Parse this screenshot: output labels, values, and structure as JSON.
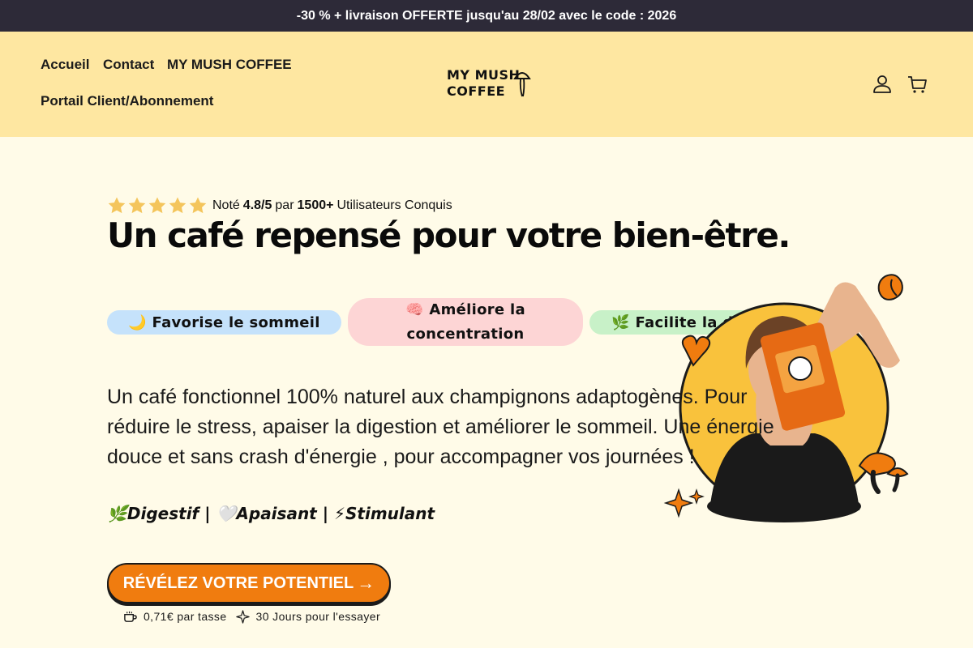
{
  "announcement": "-30 % + livraison OFFERTE jusqu'au 28/02 avec le code : 2026",
  "nav": {
    "items": [
      {
        "label": "Accueil"
      },
      {
        "label": "Contact"
      },
      {
        "label": "MY MUSH COFFEE"
      },
      {
        "label": "Portail Client/Abonnement"
      }
    ]
  },
  "logo": {
    "line1": "MY MUSH",
    "line2": "COFFEE"
  },
  "header_icons": [
    "account-icon",
    "cart-icon"
  ],
  "rating": {
    "stars": 5,
    "prefix": "Noté",
    "score": "4.8/5",
    "middle": "par",
    "count": "1500+",
    "suffix": "Utilisateurs Conquis"
  },
  "hero": {
    "title": "Un café repensé pour votre bien-être.",
    "pills": [
      {
        "label": "🌙 Favorise le sommeil"
      },
      {
        "label": "🧠 Améliore la concentration"
      },
      {
        "label": "🌿 Facilite la digestion"
      }
    ],
    "description": "Un café fonctionnel 100% naturel aux champignons adaptogènes. Pour réduire le stress, apaiser la digestion et améliorer le sommeil. Une énergie douce et sans crash d'énergie , pour accompagner vos journées !",
    "benefits": "🌿Digestif | 🤍Apaisant | ⚡Stimulant",
    "cta": "RÉVÉLEZ VOTRE POTENTIEL",
    "perks": [
      {
        "icon": "cup-icon",
        "label": "0,71€ par tasse"
      },
      {
        "icon": "sparkle-icon",
        "label": "30 Jours pour l'essayer"
      }
    ]
  },
  "colors": {
    "announcement_bg": "#2d2a38",
    "header_bg": "#fee7a1",
    "page_bg": "#fffbe8",
    "cta": "#f07c0f",
    "star": "#f4c55c",
    "pill_sleep": "#c5e2fb",
    "pill_focus": "#fdd5d5",
    "pill_digestion": "#c8f1c8"
  }
}
